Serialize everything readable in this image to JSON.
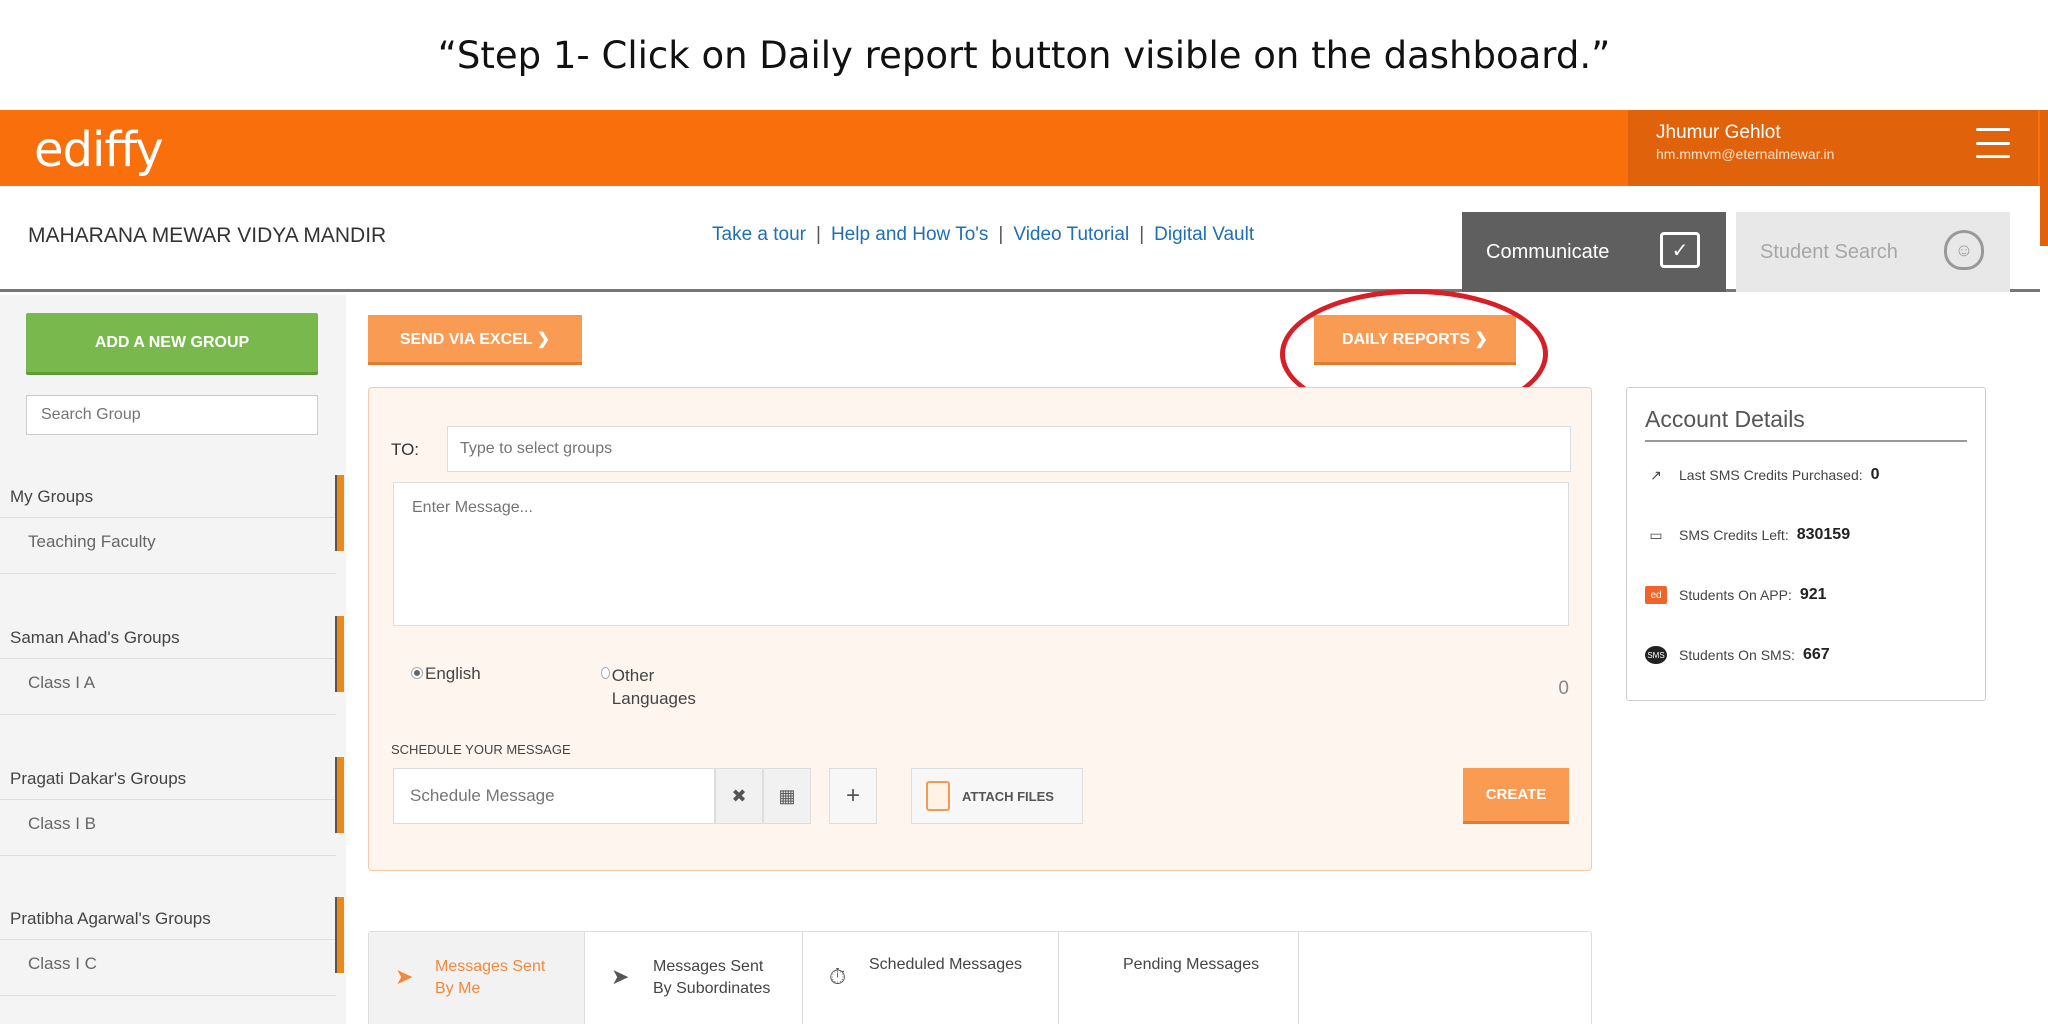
{
  "caption": "“Step 1- Click on Daily report button visible on the dashboard.”",
  "header": {
    "logo": "ediffy",
    "user_name": "Jhumur Gehlot",
    "user_email": "hm.mmvm@eternalmewar.in",
    "accent": "#f96f0b"
  },
  "subbar": {
    "school": "MAHARANA MEWAR VIDYA MANDIR",
    "links": [
      "Take a tour",
      "Help and How To's",
      "Video Tutorial",
      "Digital Vault"
    ],
    "tab_communicate": "Communicate",
    "tab_student_search": "Student Search"
  },
  "sidebar": {
    "add_group": "ADD A NEW GROUP",
    "search_placeholder": "Search Group",
    "groups": [
      {
        "title": "My Groups",
        "item": "Teaching Faculty"
      },
      {
        "title": "Saman Ahad's Groups",
        "item": "Class I A"
      },
      {
        "title": "Pragati Dakar's Groups",
        "item": "Class I B"
      },
      {
        "title": "Pratibha Agarwal's Groups",
        "item": "Class I C"
      }
    ]
  },
  "main": {
    "send_excel": "SEND VIA EXCEL ❯",
    "daily_reports": "DAILY REPORTS ❯",
    "to_label": "TO:",
    "to_placeholder": "Type to select groups",
    "message_placeholder": "Enter Message...",
    "lang_english": "English",
    "lang_other": "Other Languages",
    "char_count": "0",
    "schedule_label": "SCHEDULE YOUR MESSAGE",
    "schedule_placeholder": "Schedule Message",
    "attach_files": "ATTACH FILES",
    "create": "CREATE"
  },
  "account": {
    "title": "Account Details",
    "rows": [
      {
        "icon": "trend-icon",
        "label": "Last SMS Credits Purchased:",
        "value": "0"
      },
      {
        "icon": "card-icon",
        "label": "SMS Credits Left:",
        "value": "830159"
      },
      {
        "icon": "app-icon",
        "label": "Students On APP:",
        "value": "921"
      },
      {
        "icon": "sms-icon",
        "label": "Students On SMS:",
        "value": "667"
      }
    ]
  },
  "message_tabs": [
    {
      "label": "Messages Sent By Me",
      "active": true
    },
    {
      "label": "Messages Sent By Subordinates",
      "active": false
    },
    {
      "label": "Scheduled Messages",
      "active": false
    },
    {
      "label": "Pending Messages",
      "active": false
    }
  ]
}
